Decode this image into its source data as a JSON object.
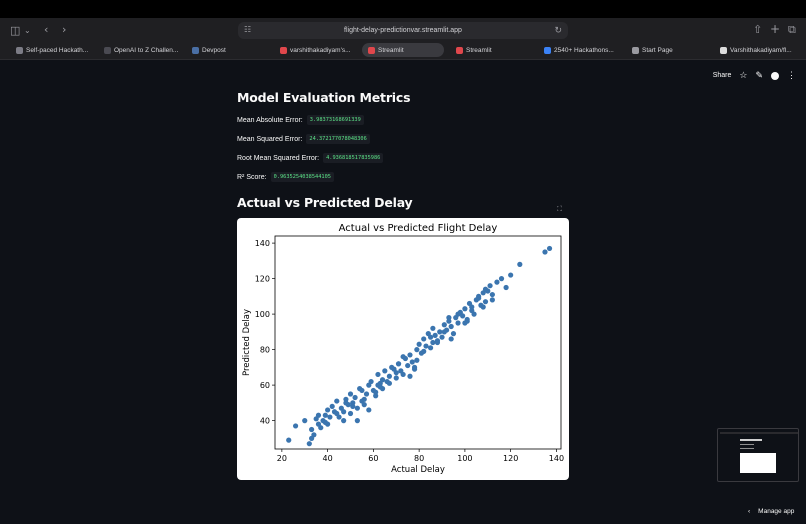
{
  "browser": {
    "url": "flight-delay-predictionvar.streamlit.app",
    "tabs": [
      {
        "label": "Self-paced Hackath...",
        "color": "#7c7c86",
        "active": false
      },
      {
        "label": "OpenAI to Z Challen...",
        "color": "#4a4a52",
        "active": false
      },
      {
        "label": "Devpost",
        "color": "#4a6fa5",
        "active": false
      },
      {
        "label": "varshithakadiyam's...",
        "color": "#e0474c",
        "active": false
      },
      {
        "label": "Streamlit",
        "color": "#e0474c",
        "active": true
      },
      {
        "label": "Streamlit",
        "color": "#e0474c",
        "active": false
      },
      {
        "label": "2540+ Hackathons...",
        "color": "#3b82f6",
        "active": false
      },
      {
        "label": "Start Page",
        "color": "#9a9aa0",
        "active": false
      },
      {
        "label": "Varshithakadiyam/fl...",
        "color": "#dcdcdc",
        "active": false
      }
    ]
  },
  "app": {
    "share_label": "Share",
    "metrics_title": "Model Evaluation Metrics",
    "metrics": [
      {
        "label": "Mean Absolute Error:",
        "value": "3.98373168691339"
      },
      {
        "label": "Mean Squared Error:",
        "value": "24.372177078048306"
      },
      {
        "label": "Root Mean Squared Error:",
        "value": "4.936818517835986"
      },
      {
        "label": "R² Score:",
        "value": "0.9635254038544105"
      }
    ],
    "chart_section_title": "Actual vs Predicted Delay",
    "manage_label": "Manage app"
  },
  "chart_data": {
    "type": "scatter",
    "title": "Actual vs Predicted Flight Delay",
    "xlabel": "Actual Delay",
    "ylabel": "Predicted Delay",
    "xlim": [
      17,
      142
    ],
    "ylim": [
      24,
      144
    ],
    "xticks": [
      20,
      40,
      60,
      80,
      100,
      120,
      140
    ],
    "yticks": [
      40,
      60,
      80,
      100,
      120,
      140
    ],
    "color": "#3b75af",
    "x": [
      23,
      26,
      30,
      32,
      33,
      34,
      35,
      36,
      37,
      38,
      39,
      40,
      40,
      41,
      42,
      43,
      44,
      45,
      46,
      47,
      48,
      49,
      50,
      50,
      51,
      52,
      53,
      54,
      55,
      56,
      57,
      58,
      59,
      60,
      61,
      62,
      62,
      63,
      64,
      65,
      66,
      67,
      68,
      69,
      70,
      71,
      72,
      73,
      74,
      75,
      76,
      77,
      78,
      79,
      80,
      81,
      82,
      83,
      84,
      85,
      86,
      87,
      88,
      89,
      90,
      91,
      92,
      93,
      94,
      95,
      96,
      97,
      98,
      99,
      100,
      101,
      102,
      103,
      104,
      105,
      106,
      107,
      108,
      109,
      110,
      111,
      112,
      114,
      116,
      118,
      120,
      124,
      135,
      137,
      33,
      36,
      39,
      44,
      47,
      51,
      53,
      56,
      58,
      61,
      64,
      67,
      70,
      73,
      76,
      79,
      82,
      85,
      88,
      91,
      94,
      97,
      100,
      103,
      106,
      109,
      112,
      48,
      55,
      63,
      71,
      78,
      86,
      93,
      101,
      108
    ],
    "y": [
      29,
      37,
      40,
      27,
      35,
      32,
      41,
      38,
      36,
      40,
      43,
      38,
      46,
      42,
      48,
      45,
      44,
      42,
      47,
      40,
      52,
      49,
      44,
      55,
      50,
      53,
      47,
      58,
      51,
      49,
      55,
      60,
      62,
      57,
      54,
      66,
      60,
      59,
      63,
      68,
      62,
      65,
      70,
      69,
      64,
      72,
      68,
      66,
      75,
      71,
      77,
      73,
      69,
      80,
      83,
      78,
      86,
      82,
      89,
      81,
      92,
      88,
      85,
      90,
      87,
      94,
      91,
      96,
      93,
      89,
      98,
      95,
      101,
      99,
      103,
      97,
      106,
      104,
      100,
      108,
      110,
      105,
      112,
      107,
      113,
      116,
      111,
      118,
      120,
      115,
      122,
      128,
      135,
      137,
      30,
      43,
      39,
      51,
      45,
      48,
      40,
      52,
      46,
      56,
      58,
      61,
      67,
      76,
      65,
      74,
      79,
      87,
      84,
      90,
      86,
      100,
      95,
      102,
      109,
      114,
      108,
      50,
      57,
      61,
      72,
      70,
      84,
      98,
      96,
      104
    ]
  }
}
